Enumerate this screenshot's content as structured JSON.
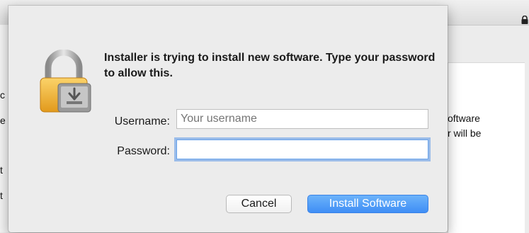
{
  "dialog": {
    "prompt": "Installer is trying to install new software. Type your password to allow this.",
    "username_label": "Username:",
    "username_placeholder": "Your username",
    "username_value": "",
    "password_label": "Password:",
    "password_value": "",
    "cancel_label": "Cancel",
    "install_label": "Install Software"
  },
  "background": {
    "right_line_1": "oftware",
    "right_line_2": "r will be"
  },
  "colors": {
    "accent": "#3f8ef5",
    "focus_ring": "#5896e8",
    "lock_gold": "#f2b233"
  },
  "icons": {
    "dialog_icon": "padlock-installer-icon",
    "titlebar_icon": "lock-icon"
  }
}
